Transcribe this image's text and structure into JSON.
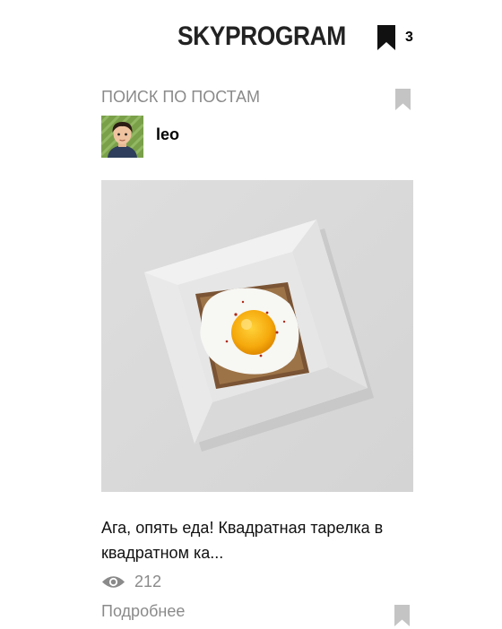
{
  "header": {
    "logo": "SKYPROGRAM",
    "bookmark_count": "3",
    "bookmark_icon": "bookmark-icon"
  },
  "search": {
    "label": "ПОИСК ПО ПОСТАМ",
    "bookmark_icon": "bookmark-icon"
  },
  "post": {
    "author": {
      "name": "leo",
      "avatar_icon": "avatar"
    },
    "image_description_icon": "post-image",
    "caption": "Ага, опять еда! Квадратная тарелка в квадратном ка...",
    "views_icon": "eye-icon",
    "views": "212",
    "more_link": "Подробнее",
    "bookmark_icon": "bookmark-icon"
  },
  "colors": {
    "muted_text": "#8a8a8a",
    "bookmark_active": "#111111",
    "bookmark_inactive": "#c4c4c4"
  }
}
